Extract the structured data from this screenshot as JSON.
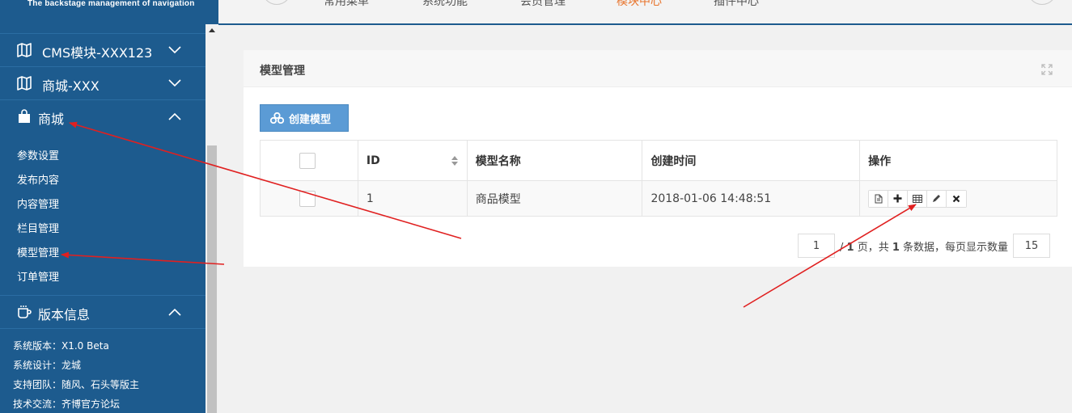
{
  "app": {
    "logo_subtitle": "The backstage management of navigation"
  },
  "topnav": {
    "tabs": [
      {
        "label": "常用菜单",
        "active": false
      },
      {
        "label": "系统功能",
        "active": false
      },
      {
        "label": "会员管理",
        "active": false
      },
      {
        "label": "模块中心",
        "active": true
      },
      {
        "label": "插件中心",
        "active": false
      }
    ]
  },
  "sidebar": {
    "groups": [
      {
        "label": "CMS模块-XXX123",
        "icon": "map-icon",
        "expanded": false
      },
      {
        "label": "商城-XXX",
        "icon": "map-icon",
        "expanded": false
      },
      {
        "label": "商城",
        "icon": "shopping-bag-icon",
        "expanded": true
      },
      {
        "label": "版本信息",
        "icon": "coffee-cup-icon",
        "expanded": true
      }
    ],
    "mall_items": [
      "参数设置",
      "发布内容",
      "内容管理",
      "栏目管理",
      "模型管理",
      "订单管理"
    ],
    "version_info": [
      "系统版本：X1.0 Beta",
      "系统设计：龙城",
      "支持团队：随风、石头等版主",
      "技术交流：齐博官方论坛"
    ]
  },
  "panel": {
    "title": "模型管理",
    "create_button": "创建模型"
  },
  "table": {
    "columns": [
      "",
      "ID",
      "模型名称",
      "创建时间",
      "操作"
    ],
    "rows": [
      {
        "id": "1",
        "name": "商品模型",
        "created": "2018-01-06 14:48:51"
      }
    ],
    "actions": [
      "document-icon",
      "plus-icon",
      "table-icon",
      "pencil-icon",
      "close-icon"
    ]
  },
  "pager": {
    "page": "1",
    "total_pages_prefix": "/ ",
    "total_pages": "1",
    "pages_suffix": " 页，共 ",
    "total_records": "1",
    "records_suffix": " 条数据，每页显示数量",
    "page_size": "15"
  },
  "colors": {
    "sidebar_bg": "#1d5b8e",
    "active_tab": "#e8742c",
    "button_bg": "#5b9bd5",
    "annotation_arrow": "#e02020"
  }
}
